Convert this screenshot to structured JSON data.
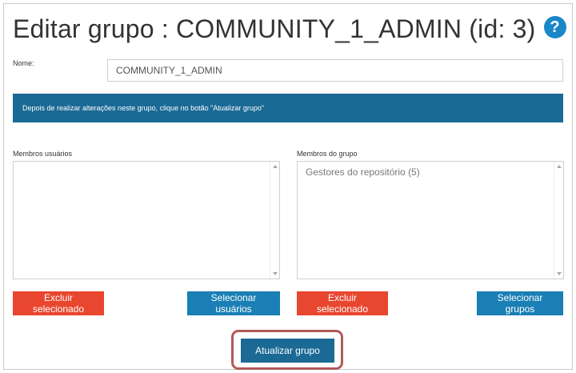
{
  "page": {
    "title": "Editar grupo : COMMUNITY_1_ADMIN (id: 3)",
    "help_icon": "?"
  },
  "form": {
    "name_label": "Nome:",
    "name_value": "COMMUNITY_1_ADMIN"
  },
  "info_message": "Depois de realizar alterações neste grupo, clique no botão \"Atualizar grupo\"",
  "members_users": {
    "label": "Membros usuários",
    "items": [],
    "delete_button": "Excluir selecionado",
    "select_button": "Selecionar usuários"
  },
  "group_members": {
    "label": "Membros do grupo",
    "items": [
      "Gestores do repositório (5)"
    ],
    "delete_button": "Excluir selecionado",
    "select_button": "Selecionar grupos"
  },
  "update_button": "Atualizar grupo",
  "colors": {
    "accent_blue": "#1a7fb5",
    "info_bar": "#1a6a95",
    "danger_red": "#e8462e",
    "highlight_border": "#b05a59"
  }
}
